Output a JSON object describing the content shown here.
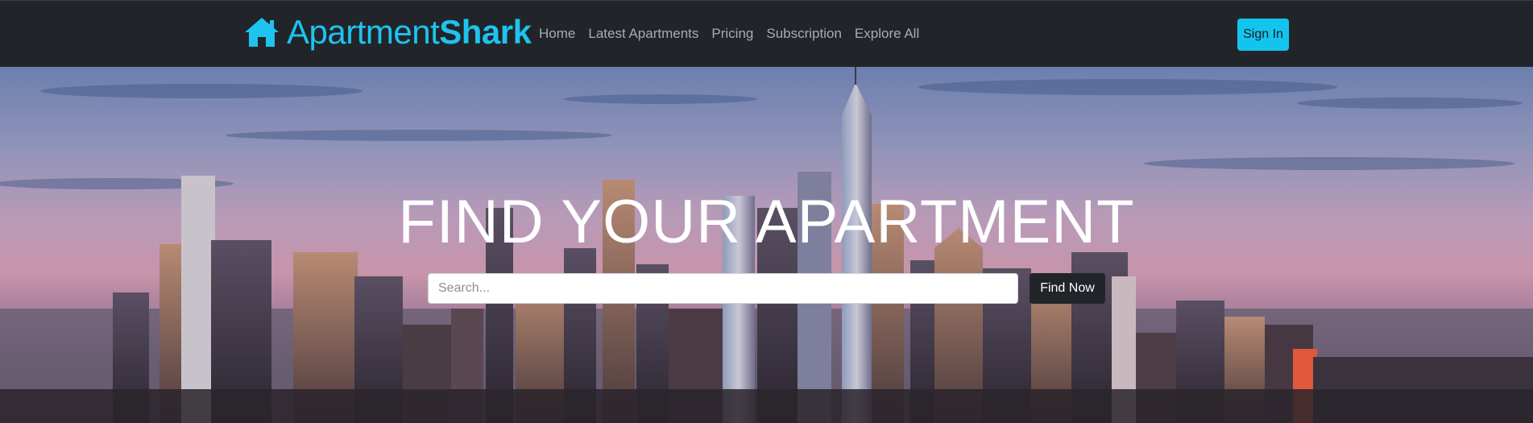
{
  "brand": {
    "name_light": "Apartment",
    "name_bold": "Shark",
    "icon": "home-icon",
    "color": "#1ec3ef"
  },
  "nav": {
    "items": [
      {
        "label": "Home"
      },
      {
        "label": "Latest Apartments"
      },
      {
        "label": "Pricing"
      },
      {
        "label": "Subscription"
      },
      {
        "label": "Explore All"
      }
    ],
    "sign_in_label": "Sign In",
    "sign_in_color": "#13c4ee",
    "background": "#212529"
  },
  "hero": {
    "title": "FIND YOUR APARTMENT",
    "search_placeholder": "Search...",
    "search_button_label": "Find Now",
    "background_image": "city-skyline-at-dusk"
  }
}
